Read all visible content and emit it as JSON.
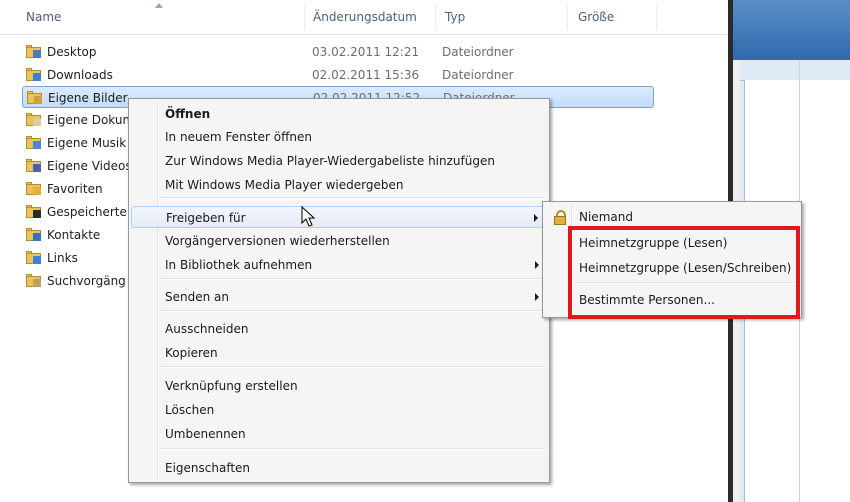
{
  "columns": {
    "name": "Name",
    "modified": "Änderungsdatum",
    "type": "Typ",
    "size": "Größe"
  },
  "files": [
    {
      "name": "Desktop",
      "date": "03.02.2011 12:21",
      "type": "Dateiordner",
      "badge": "#4a78c4"
    },
    {
      "name": "Downloads",
      "date": "02.02.2011 15:36",
      "type": "Dateiordner",
      "badge": "#3d7fd6"
    },
    {
      "name": "Eigene Bilder",
      "date": "02.02.2011 12:52",
      "type": "Dateiordner",
      "badge": "#d0a040",
      "selected": true
    },
    {
      "name": "Eigene Dokum",
      "date": "",
      "type": "",
      "badge": "#d8cfa0"
    },
    {
      "name": "Eigene Musik",
      "date": "",
      "type": "",
      "badge": "#4a84d6"
    },
    {
      "name": "Eigene Videos",
      "date": "",
      "type": "",
      "badge": "#4a5fb0"
    },
    {
      "name": "Favoriten",
      "date": "",
      "type": "",
      "badge": "#e8b030"
    },
    {
      "name": "Gespeicherte",
      "date": "",
      "type": "",
      "badge": "#2a2a2a"
    },
    {
      "name": "Kontakte",
      "date": "",
      "type": "",
      "badge": "#3a70c0"
    },
    {
      "name": "Links",
      "date": "",
      "type": "",
      "badge": "#3d7fd6"
    },
    {
      "name": "Suchvorgäng",
      "date": "",
      "type": "",
      "badge": "#c0a060"
    }
  ],
  "context_menu": {
    "items": [
      {
        "label": "Öffnen",
        "bold": true
      },
      {
        "label": "In neuem Fenster öffnen"
      },
      {
        "label": "Zur Windows Media Player-Wiedergabeliste hinzufügen"
      },
      {
        "label": "Mit Windows Media Player wiedergeben"
      },
      {
        "label": "Freigeben für",
        "submenu": true,
        "hover": true
      },
      {
        "label": "Vorgängerversionen wiederherstellen"
      },
      {
        "label": "In Bibliothek aufnehmen",
        "submenu": true
      },
      {
        "label": "Senden an",
        "submenu": true
      },
      {
        "label": "Ausschneiden"
      },
      {
        "label": "Kopieren"
      },
      {
        "label": "Verknüpfung erstellen"
      },
      {
        "label": "Löschen"
      },
      {
        "label": "Umbenennen"
      },
      {
        "label": "Eigenschaften"
      }
    ]
  },
  "share_submenu": {
    "items": [
      {
        "label": "Niemand",
        "icon": "lock-icon"
      },
      {
        "label": "Heimnetzgruppe (Lesen)"
      },
      {
        "label": "Heimnetzgruppe (Lesen/Schreiben)"
      },
      {
        "label": "Bestimmte Personen..."
      }
    ]
  },
  "colors": {
    "highlight_box": "#e0191f",
    "selection": "#c1dcfc"
  }
}
